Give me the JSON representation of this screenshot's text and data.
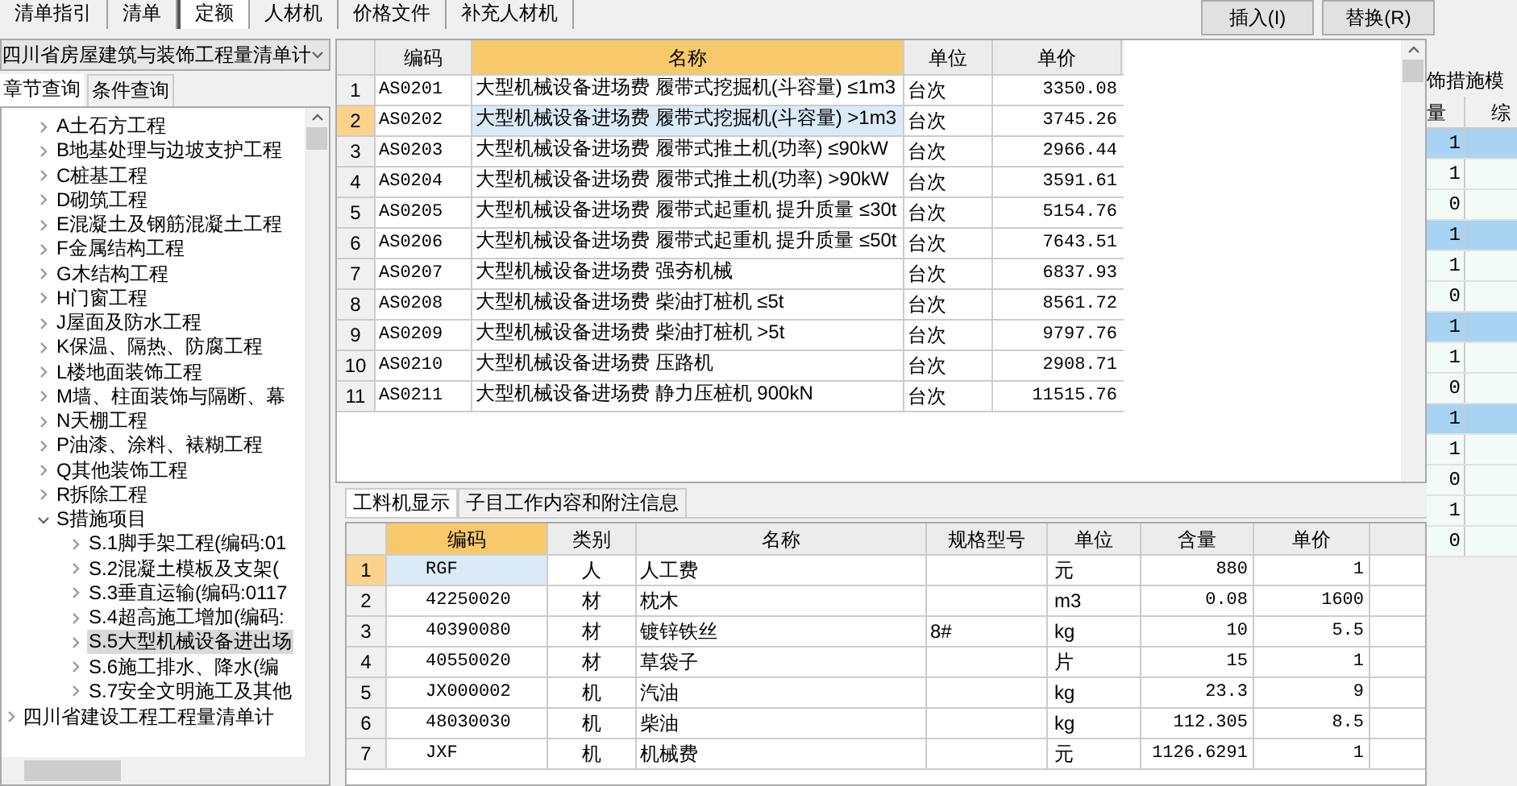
{
  "top_tabs": [
    {
      "label": "清单指引",
      "selected": false
    },
    {
      "label": "清单",
      "selected": false
    },
    {
      "label": "定额",
      "selected": true
    },
    {
      "label": "人材机",
      "selected": false
    },
    {
      "label": "价格文件",
      "selected": false
    },
    {
      "label": "补充人材机",
      "selected": false
    }
  ],
  "buttons": [
    "插入(I)",
    "替换(R)"
  ],
  "library": {
    "value": "四川省房屋建筑与装饰工程量清单计"
  },
  "left_tabs": [
    {
      "label": "章节查询",
      "selected": true
    },
    {
      "label": "条件查询",
      "selected": false
    }
  ],
  "tree": [
    {
      "label": "A土石方工程",
      "expanded": false,
      "selected": false
    },
    {
      "label": "B地基处理与边坡支护工程",
      "expanded": false,
      "selected": false
    },
    {
      "label": "C桩基工程",
      "expanded": false,
      "selected": false
    },
    {
      "label": "D砌筑工程",
      "expanded": false,
      "selected": false
    },
    {
      "label": "E混凝土及钢筋混凝土工程",
      "expanded": false,
      "selected": false
    },
    {
      "label": "F金属结构工程",
      "expanded": false,
      "selected": false
    },
    {
      "label": "G木结构工程",
      "expanded": false,
      "selected": false
    },
    {
      "label": "H门窗工程",
      "expanded": false,
      "selected": false
    },
    {
      "label": "J屋面及防水工程",
      "expanded": false,
      "selected": false
    },
    {
      "label": "K保温、隔热、防腐工程",
      "expanded": false,
      "selected": false
    },
    {
      "label": "L楼地面装饰工程",
      "expanded": false,
      "selected": false
    },
    {
      "label": "M墙、柱面装饰与隔断、幕",
      "expanded": false,
      "selected": false
    },
    {
      "label": "N天棚工程",
      "expanded": false,
      "selected": false
    },
    {
      "label": "P油漆、涂料、裱糊工程",
      "expanded": false,
      "selected": false
    },
    {
      "label": "Q其他装饰工程",
      "expanded": false,
      "selected": false
    },
    {
      "label": "R拆除工程",
      "expanded": false,
      "selected": false
    },
    {
      "label": "S措施项目",
      "expanded": true,
      "selected": false,
      "children": [
        {
          "label": "S.1脚手架工程(编码:01",
          "expanded": false,
          "selected": false
        },
        {
          "label": "S.2混凝土模板及支架(",
          "expanded": false,
          "selected": false
        },
        {
          "label": "S.3垂直运输(编码:0117",
          "expanded": false,
          "selected": false
        },
        {
          "label": "S.4超高施工增加(编码:",
          "expanded": false,
          "selected": false
        },
        {
          "label": "S.5大型机械设备进出场",
          "expanded": false,
          "selected": true
        },
        {
          "label": "S.6施工排水、降水(编",
          "expanded": false,
          "selected": false
        },
        {
          "label": "S.7安全文明施工及其他",
          "expanded": false,
          "selected": false
        }
      ]
    }
  ],
  "tree_roots_after": [
    {
      "label": "四川省建设工程工程量清单计",
      "expanded": false,
      "selected": false
    }
  ],
  "quota_table": {
    "columns": [
      {
        "label": "编码",
        "selected": false
      },
      {
        "label": "名称",
        "selected": true
      },
      {
        "label": "单位",
        "selected": false
      },
      {
        "label": "单价",
        "selected": false
      }
    ],
    "rows": [
      {
        "num": "1",
        "code": "AS0201",
        "name": "大型机械设备进场费 履带式挖掘机(斗容量) ≤1m3",
        "unit": "台次",
        "price": "3350.08",
        "selected": false
      },
      {
        "num": "2",
        "code": "AS0202",
        "name": "大型机械设备进场费 履带式挖掘机(斗容量) >1m3",
        "unit": "台次",
        "price": "3745.26",
        "selected": true
      },
      {
        "num": "3",
        "code": "AS0203",
        "name": "大型机械设备进场费 履带式推土机(功率) ≤90kW",
        "unit": "台次",
        "price": "2966.44",
        "selected": false
      },
      {
        "num": "4",
        "code": "AS0204",
        "name": "大型机械设备进场费 履带式推土机(功率) >90kW",
        "unit": "台次",
        "price": "3591.61",
        "selected": false
      },
      {
        "num": "5",
        "code": "AS0205",
        "name": "大型机械设备进场费 履带式起重机 提升质量 ≤30t",
        "unit": "台次",
        "price": "5154.76",
        "selected": false
      },
      {
        "num": "6",
        "code": "AS0206",
        "name": "大型机械设备进场费 履带式起重机 提升质量 ≤50t",
        "unit": "台次",
        "price": "7643.51",
        "selected": false
      },
      {
        "num": "7",
        "code": "AS0207",
        "name": "大型机械设备进场费 强夯机械",
        "unit": "台次",
        "price": "6837.93",
        "selected": false
      },
      {
        "num": "8",
        "code": "AS0208",
        "name": "大型机械设备进场费 柴油打桩机 ≤5t",
        "unit": "台次",
        "price": "8561.72",
        "selected": false
      },
      {
        "num": "9",
        "code": "AS0209",
        "name": "大型机械设备进场费 柴油打桩机 >5t",
        "unit": "台次",
        "price": "9797.76",
        "selected": false
      },
      {
        "num": "10",
        "code": "AS0210",
        "name": "大型机械设备进场费 压路机",
        "unit": "台次",
        "price": "2908.71",
        "selected": false
      },
      {
        "num": "11",
        "code": "AS0211",
        "name": "大型机械设备进场费 静力压桩机 900kN",
        "unit": "台次",
        "price": "11515.76",
        "selected": false
      }
    ]
  },
  "detail_tabs": [
    {
      "label": "工料机显示",
      "selected": true
    },
    {
      "label": "子目工作内容和附注信息",
      "selected": false
    }
  ],
  "resource_table": {
    "columns": [
      {
        "label": "编码",
        "selected": true
      },
      {
        "label": "类别",
        "selected": false
      },
      {
        "label": "名称",
        "selected": false
      },
      {
        "label": "规格型号",
        "selected": false
      },
      {
        "label": "单位",
        "selected": false
      },
      {
        "label": "含量",
        "selected": false
      },
      {
        "label": "单价",
        "selected": false
      }
    ],
    "rows": [
      {
        "num": "1",
        "code": "RGF",
        "category": "人",
        "name": "人工费",
        "spec": "",
        "unit": "元",
        "amount": "880",
        "price": "1",
        "selected": true
      },
      {
        "num": "2",
        "code": "42250020",
        "category": "材",
        "name": "枕木",
        "spec": "",
        "unit": "m3",
        "amount": "0.08",
        "price": "1600",
        "selected": false
      },
      {
        "num": "3",
        "code": "40390080",
        "category": "材",
        "name": "镀锌铁丝",
        "spec": "8#",
        "unit": "kg",
        "amount": "10",
        "price": "5.5",
        "selected": false
      },
      {
        "num": "4",
        "code": "40550020",
        "category": "材",
        "name": "草袋子",
        "spec": "",
        "unit": "片",
        "amount": "15",
        "price": "1",
        "selected": false
      },
      {
        "num": "5",
        "code": "JX000002",
        "category": "机",
        "name": "汽油",
        "spec": "",
        "unit": "kg",
        "amount": "23.3",
        "price": "9",
        "selected": false
      },
      {
        "num": "6",
        "code": "48030030",
        "category": "机",
        "name": "柴油",
        "spec": "",
        "unit": "kg",
        "amount": "112.305",
        "price": "8.5",
        "selected": false
      },
      {
        "num": "7",
        "code": "JXF",
        "category": "机",
        "name": "机械费",
        "spec": "",
        "unit": "元",
        "amount": "1126.6291",
        "price": "1",
        "selected": false
      }
    ]
  },
  "side_panel": {
    "title": "饰措施模",
    "columns": [
      "量",
      "综"
    ],
    "rows": [
      {
        "value": "1",
        "highlighted": true
      },
      {
        "value": "1",
        "highlighted": false
      },
      {
        "value": "0",
        "highlighted": false
      },
      {
        "value": "1",
        "highlighted": true
      },
      {
        "value": "1",
        "highlighted": false
      },
      {
        "value": "0",
        "highlighted": false
      },
      {
        "value": "1",
        "highlighted": true
      },
      {
        "value": "1",
        "highlighted": false
      },
      {
        "value": "0",
        "highlighted": false
      },
      {
        "value": "1",
        "highlighted": true
      },
      {
        "value": "1",
        "highlighted": false
      },
      {
        "value": "0",
        "highlighted": false
      },
      {
        "value": "1",
        "highlighted": false
      },
      {
        "value": "0",
        "highlighted": false
      }
    ]
  }
}
